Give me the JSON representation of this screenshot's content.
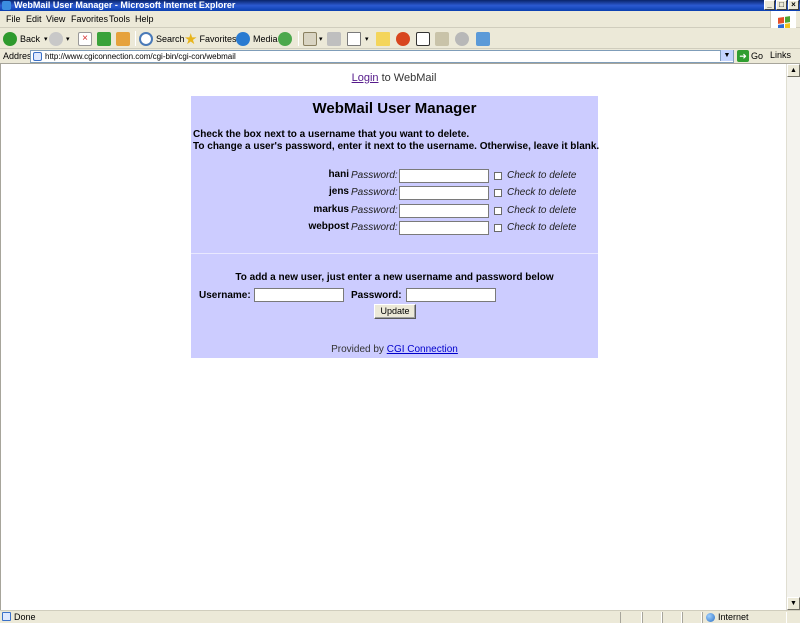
{
  "window": {
    "title": "WebMail User Manager - Microsoft Internet Explorer",
    "controls": [
      "_",
      "□",
      "×"
    ]
  },
  "menu": [
    "File",
    "Edit",
    "View",
    "Favorites",
    "Tools",
    "Help"
  ],
  "toolbar": {
    "back_label": "Back",
    "search_label": "Search",
    "favorites_label": "Favorites",
    "media_label": "Media"
  },
  "address": {
    "label": "Address",
    "url": "http://www.cgiconnection.com/cgi-bin/cgi-con/webmail",
    "go_label": "Go",
    "links_label": "Links"
  },
  "page": {
    "login_link": "Login",
    "login_suffix": " to WebMail",
    "title": "WebMail User Manager",
    "instruction_1": "Check the box next to a username that you want to delete.",
    "instruction_2": "To change a user's password, enter it next to the username. Otherwise, leave it blank.",
    "password_label": "Password:",
    "delete_label": "Check to delete",
    "users": [
      "hani",
      "jens",
      "markus",
      "webpost"
    ],
    "add_note": "To add a new user, just enter a new username and password below",
    "username_label": "Username:",
    "new_password_label": "Password:",
    "update_button": "Update",
    "provided_by": "Provided by ",
    "provider_link": "CGI Connection"
  },
  "status": {
    "text": "Done",
    "zone": "Internet"
  }
}
